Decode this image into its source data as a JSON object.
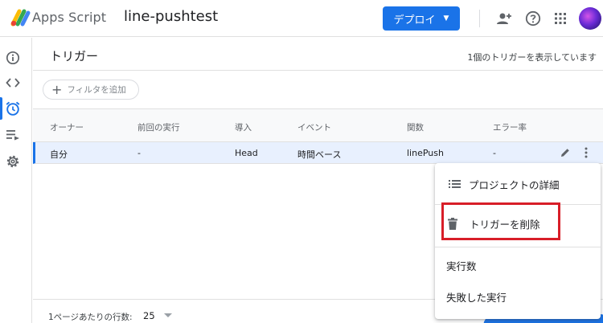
{
  "header": {
    "app_name": "Apps Script",
    "project_name": "line-pushtest",
    "deploy_label": "デプロイ",
    "icons": [
      "add-person-icon",
      "help-icon",
      "apps-grid-icon",
      "avatar"
    ]
  },
  "rail": {
    "items": [
      {
        "name": "info-icon"
      },
      {
        "name": "code-icon"
      },
      {
        "name": "alarm-icon",
        "active": true
      },
      {
        "name": "executions-icon"
      },
      {
        "name": "settings-icon"
      }
    ]
  },
  "main": {
    "title": "トリガー",
    "count_text": "1個のトリガーを表示しています",
    "filter_label": "フィルタを追加"
  },
  "table": {
    "headers": [
      "オーナー",
      "前回の実行",
      "導入",
      "イベント",
      "関数",
      "エラー率"
    ],
    "rows": [
      [
        "自分",
        "-",
        "Head",
        "時間ベース",
        "linePush",
        "-"
      ]
    ]
  },
  "footer": {
    "rows_per_page_label": "1ページあたりの行数:",
    "rows_per_page_value": "25"
  },
  "menu": {
    "items": [
      {
        "label": "プロジェクトの詳細",
        "icon": "list-icon"
      },
      {
        "label": "トリガーを削除",
        "icon": "trash-icon"
      },
      {
        "label": "実行数"
      },
      {
        "label": "失敗した実行"
      }
    ]
  },
  "colors": {
    "accent": "#1a73e8",
    "highlight": "#d81e28",
    "selected_row": "#e8f0fe"
  }
}
